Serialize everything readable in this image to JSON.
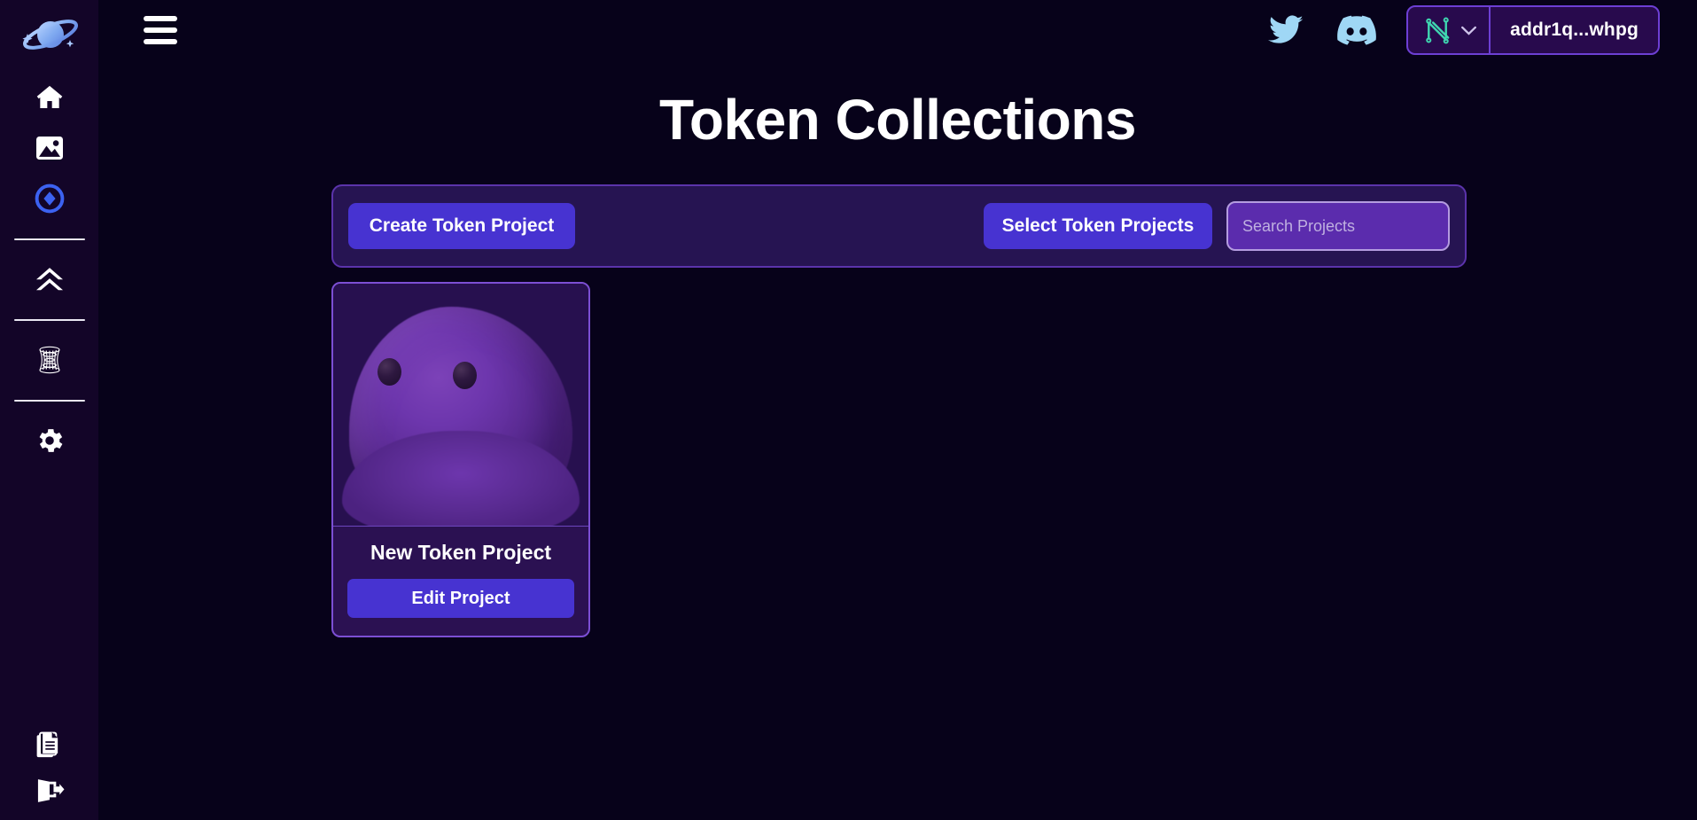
{
  "app": {
    "logo_icon": "planet-logo-icon",
    "background_color": "#07021a",
    "sidebar_color": "#130528",
    "accent_color": "#4733d1",
    "panel_color": "#261452",
    "border_accent_color": "#7c4fd4"
  },
  "sidebar": {
    "items": [
      {
        "id": "home",
        "icon": "home-icon",
        "active": false
      },
      {
        "id": "gallery",
        "icon": "image-icon",
        "active": false
      },
      {
        "id": "tokens",
        "icon": "circle-diamond-icon",
        "active": true
      },
      {
        "id": "mint",
        "icon": "double-chevron-up-icon",
        "active": false
      },
      {
        "id": "hyperboloid",
        "icon": "wireframe-hyperboloid-icon",
        "active": false
      },
      {
        "id": "settings",
        "icon": "gear-icon",
        "active": false
      }
    ],
    "bottom_items": [
      {
        "id": "docs",
        "icon": "documents-icon"
      },
      {
        "id": "logout",
        "icon": "logout-icon"
      }
    ]
  },
  "topbar": {
    "menu_icon": "hamburger-menu-icon",
    "twitter_icon": "twitter-icon",
    "discord_icon": "discord-icon",
    "wallet": {
      "provider_icon": "nami-wallet-icon",
      "chevron_icon": "chevron-down-icon",
      "address": "addr1q...whpg"
    }
  },
  "main": {
    "title": "Token Collections",
    "toolbar": {
      "create_label": "Create Token Project",
      "select_label": "Select Token Projects",
      "search_placeholder": "Search Projects",
      "search_value": "",
      "search_icon": "search-icon"
    },
    "projects": [
      {
        "title": "New Token Project",
        "edit_label": "Edit Project",
        "thumbnail_icon": "purple-blob-character"
      }
    ]
  }
}
